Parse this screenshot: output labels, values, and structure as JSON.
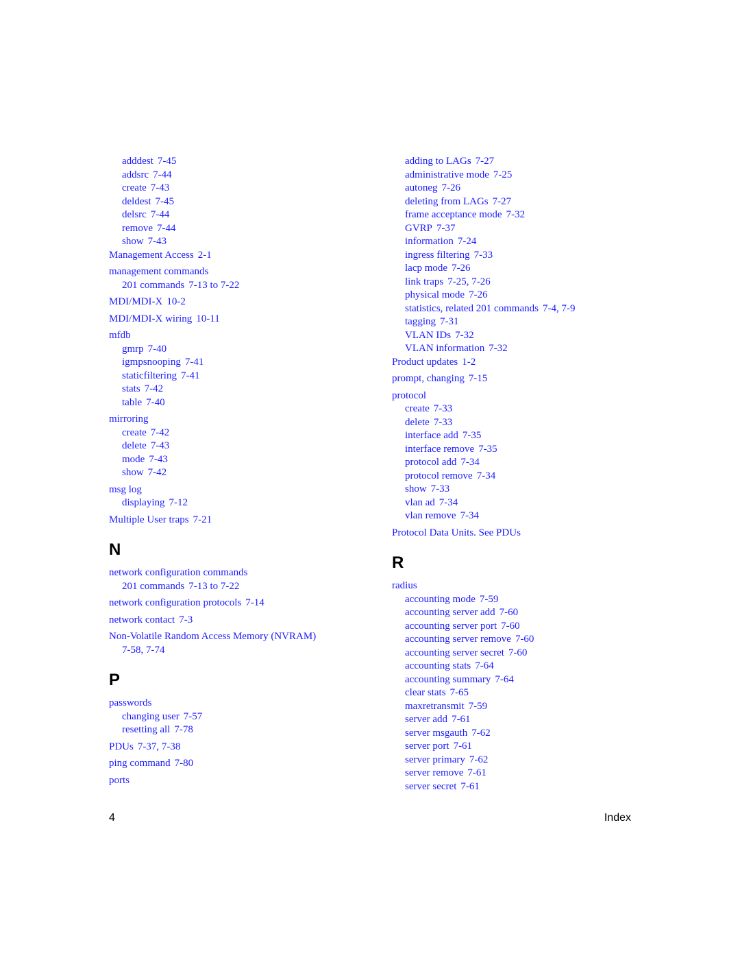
{
  "left_column": {
    "top_subs": [
      {
        "term": "adddest",
        "loc": "7-45"
      },
      {
        "term": "addsrc",
        "loc": "7-44"
      },
      {
        "term": "create",
        "loc": "7-43"
      },
      {
        "term": "deldest",
        "loc": "7-45"
      },
      {
        "term": "delsrc",
        "loc": "7-44"
      },
      {
        "term": "remove",
        "loc": "7-44"
      },
      {
        "term": "show",
        "loc": "7-43"
      }
    ],
    "m_entries": [
      {
        "term": "Management Access",
        "loc": "2-1"
      },
      {
        "term": "management commands",
        "loc": "",
        "subs": [
          {
            "term": "201 commands",
            "loc": "7-13 to 7-22"
          }
        ]
      },
      {
        "term": "MDI/MDI-X",
        "loc": "10-2"
      },
      {
        "term": "MDI/MDI-X wiring",
        "loc": "10-11"
      },
      {
        "term": "mfdb",
        "loc": "",
        "subs": [
          {
            "term": "gmrp",
            "loc": "7-40"
          },
          {
            "term": "igmpsnooping",
            "loc": "7-41"
          },
          {
            "term": "staticfiltering",
            "loc": "7-41"
          },
          {
            "term": "stats",
            "loc": "7-42"
          },
          {
            "term": "table",
            "loc": "7-40"
          }
        ]
      },
      {
        "term": "mirroring",
        "loc": "",
        "subs": [
          {
            "term": "create",
            "loc": "7-42"
          },
          {
            "term": "delete",
            "loc": "7-43"
          },
          {
            "term": "mode",
            "loc": "7-43"
          },
          {
            "term": "show",
            "loc": "7-42"
          }
        ]
      },
      {
        "term": "msg log",
        "loc": "",
        "subs": [
          {
            "term": "displaying",
            "loc": "7-12"
          }
        ]
      },
      {
        "term": "Multiple User traps",
        "loc": "7-21"
      }
    ],
    "letter_n": "N",
    "n_entries": [
      {
        "term": "network configuration commands",
        "loc": "",
        "subs": [
          {
            "term": "201 commands",
            "loc": "7-13 to 7-22"
          }
        ]
      },
      {
        "term": "network configuration protocols",
        "loc": "7-14"
      },
      {
        "term": "network contact",
        "loc": "7-3"
      },
      {
        "term": "Non-Volatile Random Access Memory (NVRAM)",
        "loc": "",
        "continuation": "7-58, 7-74"
      }
    ],
    "letter_p": "P",
    "p_entries": [
      {
        "term": "passwords",
        "loc": "",
        "subs": [
          {
            "term": "changing user",
            "loc": "7-57"
          },
          {
            "term": "resetting all",
            "loc": "7-78"
          }
        ]
      },
      {
        "term": "PDUs",
        "loc": "7-37, 7-38"
      },
      {
        "term": "ping command",
        "loc": "7-80"
      },
      {
        "term": "ports",
        "loc": ""
      }
    ]
  },
  "right_column": {
    "top_subs": [
      {
        "term": "adding to LAGs",
        "loc": "7-27"
      },
      {
        "term": "administrative mode",
        "loc": "7-25"
      },
      {
        "term": "autoneg",
        "loc": "7-26"
      },
      {
        "term": "deleting from LAGs",
        "loc": "7-27"
      },
      {
        "term": "frame acceptance mode",
        "loc": "7-32"
      },
      {
        "term": "GVRP",
        "loc": "7-37"
      },
      {
        "term": "information",
        "loc": "7-24"
      },
      {
        "term": "ingress filtering",
        "loc": "7-33"
      },
      {
        "term": "lacp mode",
        "loc": "7-26"
      },
      {
        "term": "link traps",
        "loc": "7-25, 7-26"
      },
      {
        "term": "physical mode",
        "loc": "7-26"
      },
      {
        "term": "statistics, related 201 commands",
        "loc": "7-4, 7-9"
      },
      {
        "term": "tagging",
        "loc": "7-31"
      },
      {
        "term": "VLAN IDs",
        "loc": "7-32"
      },
      {
        "term": "VLAN information",
        "loc": "7-32"
      }
    ],
    "p_entries": [
      {
        "term": "Product updates",
        "loc": "1-2"
      },
      {
        "term": "prompt, changing",
        "loc": "7-15"
      },
      {
        "term": "protocol",
        "loc": "",
        "subs": [
          {
            "term": "create",
            "loc": "7-33"
          },
          {
            "term": "delete",
            "loc": "7-33"
          },
          {
            "term": "interface add",
            "loc": "7-35"
          },
          {
            "term": "interface remove",
            "loc": "7-35"
          },
          {
            "term": "protocol add",
            "loc": "7-34"
          },
          {
            "term": "protocol remove",
            "loc": "7-34"
          },
          {
            "term": "show",
            "loc": "7-33"
          },
          {
            "term": "vlan ad",
            "loc": "7-34"
          },
          {
            "term": "vlan remove",
            "loc": "7-34"
          }
        ]
      },
      {
        "term": "Protocol Data Units. See PDUs",
        "loc": ""
      }
    ],
    "letter_r": "R",
    "r_entries": [
      {
        "term": "radius",
        "loc": "",
        "subs": [
          {
            "term": "accounting mode",
            "loc": "7-59"
          },
          {
            "term": "accounting server add",
            "loc": "7-60"
          },
          {
            "term": "accounting server port",
            "loc": "7-60"
          },
          {
            "term": "accounting server remove",
            "loc": "7-60"
          },
          {
            "term": "accounting server secret",
            "loc": "7-60"
          },
          {
            "term": "accounting stats",
            "loc": "7-64"
          },
          {
            "term": "accounting summary",
            "loc": "7-64"
          },
          {
            "term": "clear stats",
            "loc": "7-65"
          },
          {
            "term": "maxretransmit",
            "loc": "7-59"
          },
          {
            "term": "server add",
            "loc": "7-61"
          },
          {
            "term": "server msgauth",
            "loc": "7-62"
          },
          {
            "term": "server port",
            "loc": "7-61"
          },
          {
            "term": "server primary",
            "loc": "7-62"
          },
          {
            "term": "server remove",
            "loc": "7-61"
          },
          {
            "term": "server secret",
            "loc": "7-61"
          }
        ]
      }
    ]
  },
  "footer": {
    "page_number": "4",
    "section": "Index"
  },
  "colors": {
    "link": "#1a1aff",
    "heading": "#000000"
  }
}
